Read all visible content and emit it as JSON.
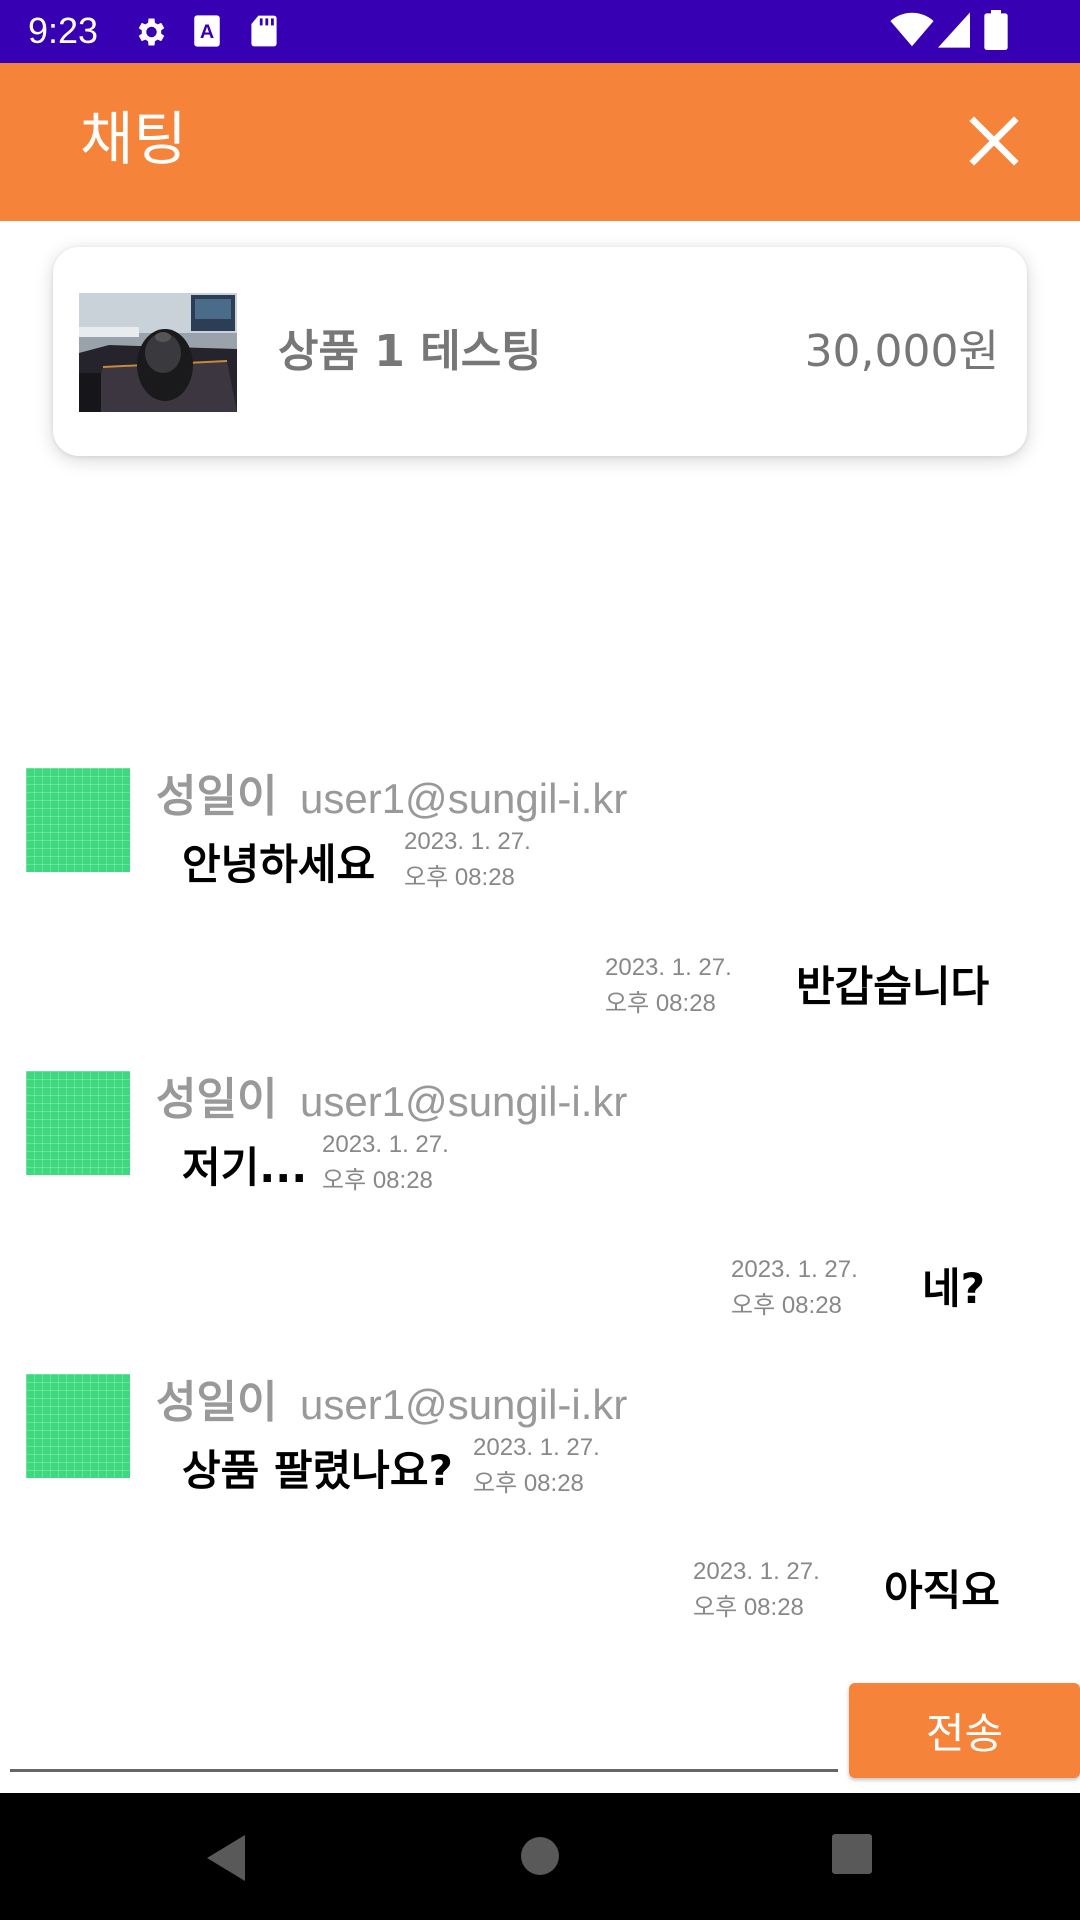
{
  "status_bar": {
    "time": "9:23",
    "icons": [
      "gear-icon",
      "keyboard-a-icon",
      "sd-card-icon",
      "wifi-icon",
      "signal-icon",
      "battery-icon"
    ]
  },
  "app_bar": {
    "title": "채팅",
    "close_icon": "close-icon"
  },
  "product": {
    "name": "상품 1 테스팅",
    "price": "30,000원"
  },
  "messages": [
    {
      "direction": "in",
      "sender": "성일이",
      "email": "user1@sungil-i.kr",
      "text": "안녕하세요",
      "date": "2023. 1. 27.",
      "time": "오후 08:28"
    },
    {
      "direction": "out",
      "text": "반갑습니다",
      "date": "2023. 1. 27.",
      "time": "오후 08:28"
    },
    {
      "direction": "in",
      "sender": "성일이",
      "email": "user1@sungil-i.kr",
      "text": "저기...",
      "date": "2023. 1. 27.",
      "time": "오후 08:28"
    },
    {
      "direction": "out",
      "text": "네?",
      "date": "2023. 1. 27.",
      "time": "오후 08:28"
    },
    {
      "direction": "in",
      "sender": "성일이",
      "email": "user1@sungil-i.kr",
      "text": "상품 팔렸나요?",
      "date": "2023. 1. 27.",
      "time": "오후 08:28"
    },
    {
      "direction": "out",
      "text": "아직요",
      "date": "2023. 1. 27.",
      "time": "오후 08:28"
    }
  ],
  "input": {
    "value": "",
    "placeholder": "",
    "send_label": "전송"
  },
  "colors": {
    "status_bar": "#3700b3",
    "app_bar": "#f5833a",
    "accent": "#f5833a",
    "avatar": "#3ed97e"
  },
  "nav_bar": {
    "icons": [
      "back-icon",
      "home-icon",
      "recents-icon"
    ]
  }
}
